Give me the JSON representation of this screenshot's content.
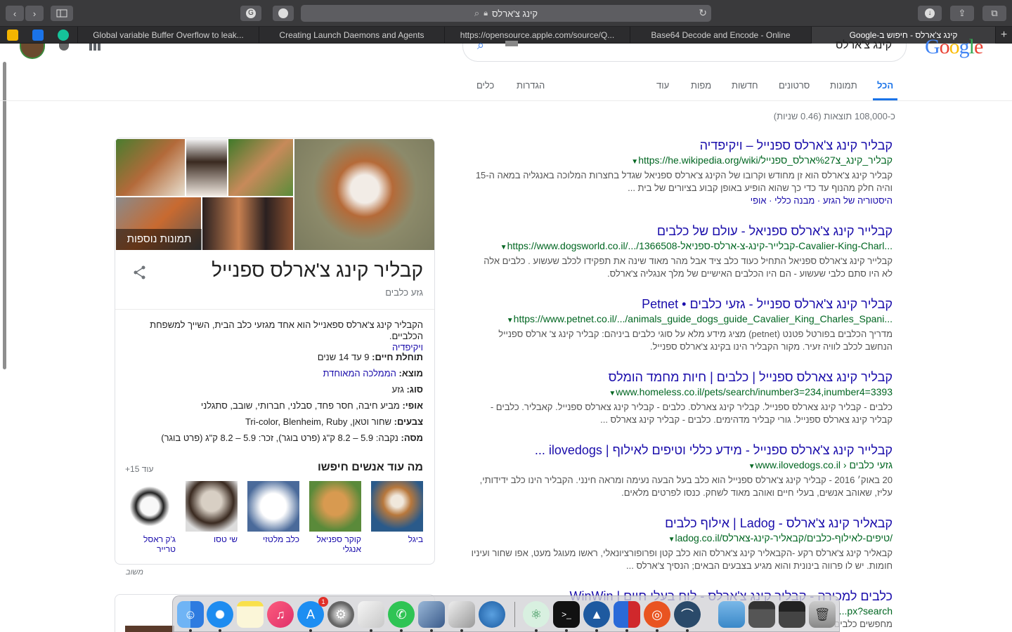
{
  "browser": {
    "address": "קינג צ'ארלס",
    "tabs": [
      "Global variable Buffer Overflow to leak...",
      "Creating Launch Daemons and Agents",
      "https://opensource.apple.com/source/Q...",
      "Base64 Decode and Encode - Online",
      "קינג צ'ארלס - חיפוש ב-Google"
    ],
    "new_tab": "+"
  },
  "google": {
    "query": "קינג צ'ארלס",
    "logo": "Google",
    "nav": [
      "הכל",
      "תמונות",
      "סרטונים",
      "חדשות",
      "מפות",
      "עוד",
      "הגדרות",
      "כלים"
    ],
    "result_count": "כ-108,000 תוצאות (0.46 שניות)"
  },
  "results": [
    {
      "title": "קבליר קינג צ'ארלס ספנייל – ויקיפדיה",
      "url": "https://he.wikipedia.org/wiki/קבליר_קינג_צ%27ארלס_ספנייל",
      "snippet": "קבליר קינג צ'ארלס הוא זן מחודש וקרובו של הקינג צ'ארלס ספניאל שגדל בחצרות המלוכה באנגליה במאה ה-15 והיה חלק מהנוף עד כדי כך שהוא הופיע באופן קבוע בציורים של בית ...",
      "links": "היסטוריה של הגזע · מבנה כללי · אופי"
    },
    {
      "title": "קבלייר קינג צ'ארלס ספניאל - עולם של כלבים",
      "url": "https://www.dogsworld.co.il/.../1366508-קבלייר-קינג-צ-ארלס-ספניאל-Cavalier-King-Charl...",
      "snippet": "קבלייר קינג צ'ארלס ספניאל התחיל כעוד כלב ציד אבל מהר מאוד שינה את תפקידו לכלב שעשוע . כלבים אלה לא היו סתם כלבי שעשוע - הם היו הכלבים האישיים של מלך אנגליה צ'ארלס."
    },
    {
      "title": "קבליר קינג צ'ארלס ספנייל - גזעי כלבים • Petnet",
      "url": "https://www.petnet.co.il/.../animals_guide_dogs_guide_Cavalier_King_Charles_Spani...",
      "snippet": "מדריך הכלבים בפורטל פטנט (petnet) מציג מידע מלא על סוגי כלבים ביניהם: קבליר קינג צ' ארלס ספנייל הנחשב לכלב לוויה זעיר. מקור הקבליר הינו בקינג צ'ארלס ספנייל."
    },
    {
      "title": "קבליר קינג צארלס ספנייל | כלבים | חיות מחמד הומלס",
      "url": "www.homeless.co.il/pets/search/inumber3=234,inumber4=3393",
      "snippet": "כלבים - קבליר קינג צארלס ספנייל. קבליר קינג צארלס. כלבים - קבליר קינג צארלס ספנייל. קאבליר. כלבים - קבליר קינג צארלס ספנייל. גורי קבליר מדהימים. כלבים - קבליר קינג צארלס ..."
    },
    {
      "title": "קבלייר קינג צ'ארלס ספנייל - מידע כללי וטיפים לאילוף | ilovedogs ...",
      "url": "www.ilovedogs.co.il › גזעי כלבים",
      "snippet": "20 באוק׳ 2016 - קבליר קינג צ'ארלס ספנייל הוא כלב בעל הבעה נעימה ומראה חינני. הקבליר הינו כלב ידידותי, עליז, שאוהב אנשים, בעלי חיים ואוהב מאוד לשחק. כנסו לפרטים מלאים."
    },
    {
      "title": "קבאליר קינג צ'ארלס - Ladog | אילוף כלבים",
      "url": "ladog.co.il/טיפים-לאילוף-כלבים/קבאליר-קינג-צארלס/",
      "snippet": "קבאליר קינג צ'ארלס רקע -הקבאליר קינג צ'ארלס הוא כלב קטן ופרופורציונאלי, ראשו מעוגל מעט, אפו שחור ועיניו חומות. יש לו פרווה בינונית והוא מגיע בצבעים הבאים; הנסיך צ'ארלס ..."
    },
    {
      "title": "כלבים למכירה - קבליר קינג צ'ארלס - לוח בעלי חיים | WinWin",
      "url": "...px?search",
      "snippet": "מחפשים כלבים"
    }
  ],
  "knowledge_panel": {
    "more_images": "תמונות נוספות",
    "title": "קבליר קינג צ'ארלס ספנייל",
    "subtitle": "גזע כלבים",
    "description": "הקבליר קינג צ'ארלס ספאנייל הוא אחד מגזעי כלב הבית, השייך למשפחת הכלביים.",
    "wiki": "ויקיפדיה",
    "facts": [
      {
        "label": "תוחלת חיים:",
        "value": " 9 עד 14 שנים"
      },
      {
        "label": "מוצא:",
        "value": " הממלכה המאוחדת"
      },
      {
        "label": "סוג:",
        "value": " גזע"
      },
      {
        "label": "אופי:",
        "value": " מביע חיבה, חסר פחד, סבלני, חברותי, שובב, סתגלני"
      },
      {
        "label": "צבעים:",
        "value": " שחור וטאן, Tri-color, Blenheim, Ruby"
      },
      {
        "label": "מסה:",
        "value": " נקבה: 5.9 – 8.2 ק\"ג (פרט בוגר), זכר: 5.9 – 8.2 ק\"ג (פרט בוגר)"
      }
    ],
    "pasa_title": "מה עוד אנשים חיפשו",
    "pasa_more": "עוד 15+",
    "pasa": [
      "ביגל",
      "קוקר ספניאל אנגלי",
      "כלב מלטזי",
      "שי טסו",
      "ג'ק ראסל טרייר"
    ],
    "feedback": "משוב"
  },
  "dock": {
    "appstore_badge": "1",
    "apps": [
      "finder-icon",
      "safari-icon",
      "notes-icon",
      "music-icon",
      "appstore-icon",
      "settings-icon",
      "textedit-icon",
      "whatsapp-icon",
      "preview-icon",
      "script-icon",
      "globe-icon",
      "atom-icon",
      "terminal-icon",
      "sourcetree-icon",
      "vm-icon",
      "ubuntu-icon",
      "wireshark-icon",
      "folder-icon",
      "window1-icon",
      "window2-icon",
      "trash-icon"
    ]
  }
}
